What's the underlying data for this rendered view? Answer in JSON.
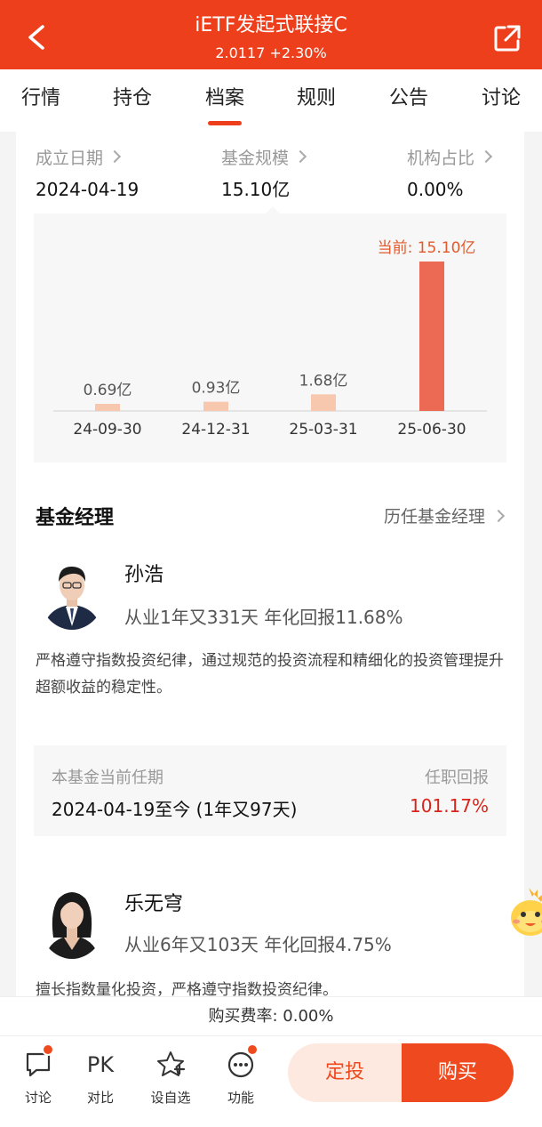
{
  "header": {
    "title": "iETF发起式联接C",
    "nav_subtitle": "2.0117 +2.30%",
    "bg_color": "#ee3f1c"
  },
  "tabs": [
    {
      "label": "行情"
    },
    {
      "label": "持仓"
    },
    {
      "label": "档案",
      "active": true
    },
    {
      "label": "规则"
    },
    {
      "label": "公告"
    },
    {
      "label": "讨论"
    }
  ],
  "stats": [
    {
      "label": "成立日期",
      "value": "2024-04-19"
    },
    {
      "label": "基金规模",
      "value": "15.10亿"
    },
    {
      "label": "机构占比",
      "value": "0.00%"
    }
  ],
  "chart_data": {
    "type": "bar",
    "categories": [
      "24-09-30",
      "24-12-31",
      "25-03-31",
      "25-06-30"
    ],
    "values": [
      0.69,
      0.93,
      1.68,
      15.1
    ],
    "data_labels": [
      "0.69亿",
      "0.93亿",
      "1.68亿",
      "当前: 15.10亿"
    ],
    "ylim": [
      0,
      15.1
    ],
    "colors": {
      "normal": "#f8c8ae",
      "current": "#ec6a53",
      "current_label": "#e25a2c"
    }
  },
  "managers_section": {
    "title": "基金经理",
    "history_link": "历任基金经理"
  },
  "managers": [
    {
      "name": "孙浩",
      "stat": "从业1年又331天 年化回报11.68%",
      "desc": "严格遵守指数投资纪律，通过规范的投资流程和精细化的投资管理提升超额收益的稳定性。",
      "tenure_label": "本基金当前任期",
      "return_label": "任职回报",
      "tenure_value": "2024-04-19至今 (1年又97天)",
      "return_value": "101.17%"
    },
    {
      "name": "乐无穹",
      "stat": "从业6年又103天 年化回报4.75%",
      "desc": "擅长指数量化投资，严格遵守指数投资纪律。"
    }
  ],
  "fee": {
    "text": "购买费率: 0.00%"
  },
  "bottom_nav": [
    {
      "label": "讨论",
      "icon": "chat-icon"
    },
    {
      "label": "对比",
      "icon": "pk-icon",
      "glyph": "PK"
    },
    {
      "label": "设自选",
      "icon": "star-icon"
    },
    {
      "label": "功能",
      "icon": "more-icon"
    }
  ],
  "actions": {
    "dingtou": "定投",
    "buy": "购买"
  }
}
